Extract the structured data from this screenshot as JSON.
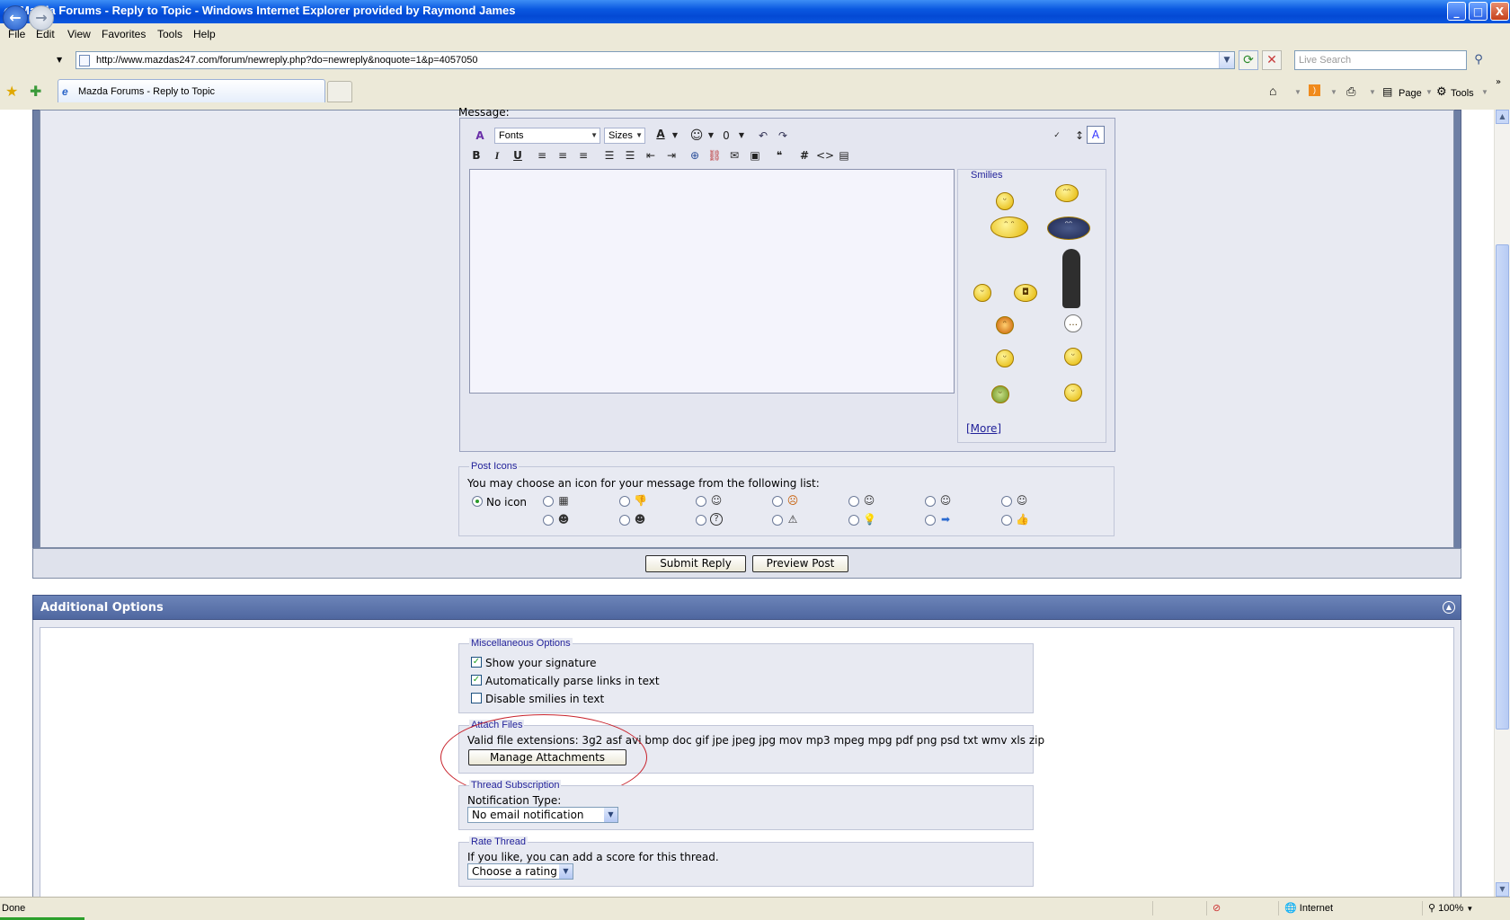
{
  "window": {
    "title": "Mazda Forums - Reply to Topic - Windows Internet Explorer provided by Raymond James",
    "min": "_",
    "max": "□",
    "close": "X"
  },
  "menu": [
    "File",
    "Edit",
    "View",
    "Favorites",
    "Tools",
    "Help"
  ],
  "address": {
    "url": "http://www.mazdas247.com/forum/newreply.php?do=newreply&noquote=1&p=4057050",
    "search_placeholder": "Live Search"
  },
  "tab": {
    "title": "Mazda Forums - Reply to Topic"
  },
  "toolbar": {
    "page": "Page",
    "tools": "Tools"
  },
  "editor": {
    "message_label": "Message:",
    "font_select": "Fonts",
    "size_select": "Sizes",
    "smilies_legend": "Smilies",
    "more_link": "[More]"
  },
  "post_icons": {
    "legend": "Post Icons",
    "description": "You may choose an icon for your message from the following list:",
    "no_icon_label": "No icon",
    "selected": "No icon",
    "icons_row1": [
      "note-icon",
      "thumbs-down-icon",
      "wink-icon",
      "angry-icon",
      "smile-icon",
      "cool-icon",
      "tongue-icon"
    ],
    "icons_row2": [
      "grin-icon",
      "sunglasses-icon",
      "question-icon",
      "warning-icon",
      "lightbulb-icon",
      "arrow-icon",
      "thumbs-up-icon"
    ]
  },
  "buttons": {
    "submit": "Submit Reply",
    "preview": "Preview Post"
  },
  "additional": {
    "header": "Additional Options",
    "misc_legend": "Miscellaneous Options",
    "misc_options": [
      {
        "label": "Show your signature",
        "checked": true
      },
      {
        "label": "Automatically parse links in text",
        "checked": true
      },
      {
        "label": "Disable smilies in text",
        "checked": false
      }
    ],
    "attach_legend": "Attach Files",
    "valid_ext": "Valid file extensions: 3g2 asf avi bmp doc gif jpe jpeg jpg mov mp3 mpeg mpg pdf png psd txt wmv xls zip",
    "manage_btn": "Manage Attachments",
    "subscription_legend": "Thread Subscription",
    "notification_label": "Notification Type:",
    "notification_value": "No email notification",
    "rate_legend": "Rate Thread",
    "rate_text": "If you like, you can add a score for this thread.",
    "rate_value": "Choose a rating"
  },
  "status": {
    "text": "Done",
    "zone": "Internet",
    "zoom": "100%"
  }
}
